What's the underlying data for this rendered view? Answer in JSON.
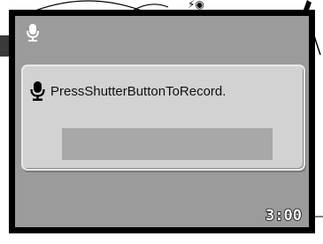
{
  "message": "PressShutterButtonToRecord.",
  "time_remaining": "3:00",
  "record_progress": 0,
  "icons": {
    "status": "microphone-icon",
    "message": "microphone-icon"
  },
  "colors": {
    "screen_background": "#9b9b9b",
    "dialog_background": "#d2d2d2",
    "progress_track": "#a8a8a8",
    "bezel": "#000000"
  }
}
